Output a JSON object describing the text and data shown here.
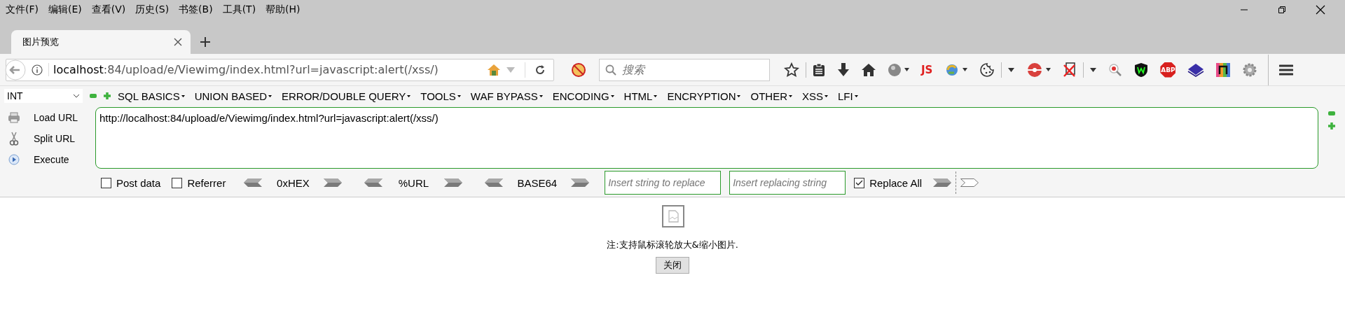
{
  "menu_bar": [
    "文件(F)",
    "编辑(E)",
    "查看(V)",
    "历史(S)",
    "书签(B)",
    "工具(T)",
    "帮助(H)"
  ],
  "tabs": [
    {
      "label": "图片预览",
      "selected": true
    }
  ],
  "address_bar": {
    "host": "localhost",
    "rest": ":84/upload/e/Viewimg/index.html?url=javascript:alert(/xss/)"
  },
  "search": {
    "placeholder": "搜索"
  },
  "toolbar_texts": {
    "js": "JS",
    "abp": "ABP"
  },
  "hackbar": {
    "select": "INT",
    "menus": [
      "SQL BASICS",
      "UNION BASED",
      "ERROR/DOUBLE QUERY",
      "TOOLS",
      "WAF BYPASS",
      "ENCODING",
      "HTML",
      "ENCRYPTION",
      "OTHER",
      "XSS",
      "LFI"
    ],
    "actions": [
      "Load URL",
      "Split URL",
      "Execute"
    ],
    "url": "http://localhost:84/upload/e/Viewimg/index.html?url=javascript:alert(/xss/)",
    "options": [
      {
        "label": "Post data",
        "checked": false
      },
      {
        "label": "Referrer",
        "checked": false
      }
    ],
    "encoders": [
      "0xHEX",
      "%URL",
      "BASE64"
    ],
    "find_placeholder": "Insert string to replace",
    "replace_placeholder": "Insert replacing string",
    "replace_all": {
      "label": "Replace All",
      "checked": true
    }
  },
  "page": {
    "note": "注:支持鼠标滚轮放大&缩小图片.",
    "close_button": "关闭"
  }
}
